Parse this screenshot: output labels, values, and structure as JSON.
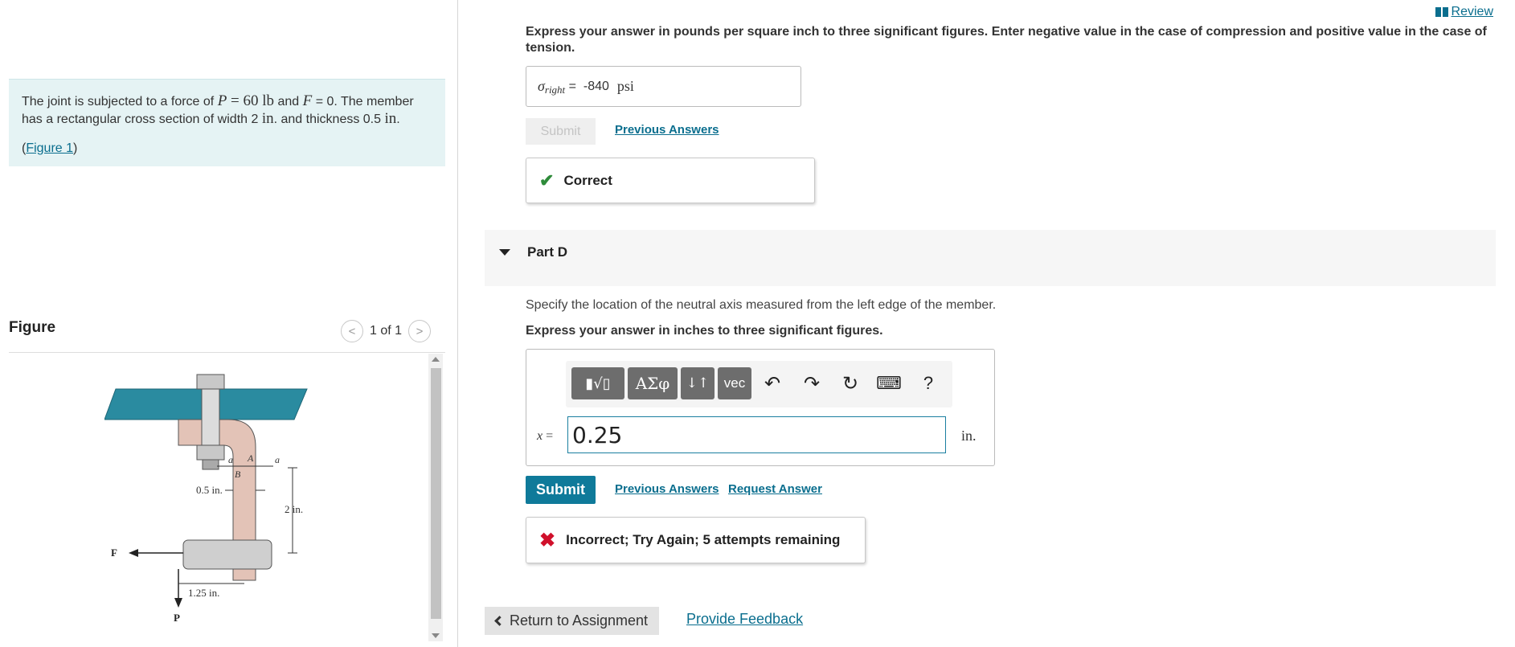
{
  "header": {
    "review_label": "Review"
  },
  "intro": {
    "t1": "The joint is subjected to a force of ",
    "p_sym": "P",
    "p_eq": " = 60 ",
    "p_unit": "lb",
    "t2": " and ",
    "f_sym": "F",
    "t3": " = 0. The member has a rectangular cross section of width 2 ",
    "w_unit": "in",
    "t4": ". and thickness 0.5 ",
    "t_unit": "in",
    "t5": ".",
    "fig_open": "(",
    "fig_link": "Figure 1",
    "fig_close": ")"
  },
  "figure_panel": {
    "title": "Figure",
    "pager": "1 of 1",
    "prev_glyph": "<",
    "next_glyph": ">",
    "labels": {
      "a1": "a",
      "a2": "a",
      "A": "A",
      "B": "B",
      "thick": "0.5 in.",
      "width": "2 in.",
      "offset": "1.25 in.",
      "F": "F",
      "P": "P"
    }
  },
  "part_c": {
    "instruction": "Express your answer in pounds per square inch to three significant figures. Enter negative value in the case of compression and positive value in the case of tension.",
    "sigma": "σ",
    "sigma_sub": "right",
    "eq": " = ",
    "value": "-840",
    "unit": "psi",
    "submit_label": "Submit",
    "prev_answers": "Previous Answers",
    "result": "Correct"
  },
  "part_d": {
    "title": "Part D",
    "prompt": "Specify the location of the neutral axis measured from the left edge of the member.",
    "instruction": "Express your answer in inches to three significant figures.",
    "toolbar": {
      "templates": "▮√▯",
      "greek": "ΑΣφ",
      "arrows": "↓↑",
      "vec": "vec",
      "undo": "↶",
      "redo": "↷",
      "reset": "↻",
      "keyboard": "⌨",
      "help": "?"
    },
    "var": "x",
    "eq": " =",
    "value": "0.25",
    "unit": "in.",
    "submit_label": "Submit",
    "prev_answers": "Previous Answers",
    "request_answer": "Request Answer",
    "result": "Incorrect; Try Again; 5 attempts remaining"
  },
  "footer": {
    "return_label": "Return to Assignment",
    "feedback_label": "Provide Feedback"
  },
  "colors": {
    "accent": "#0f7a9a",
    "link": "#0a6e8e",
    "correct": "#2e8b3a",
    "incorrect": "#d0102b",
    "intro_bg": "#e5f3f4",
    "ceiling": "#2a8ba0",
    "member": "#e3c3b7"
  }
}
